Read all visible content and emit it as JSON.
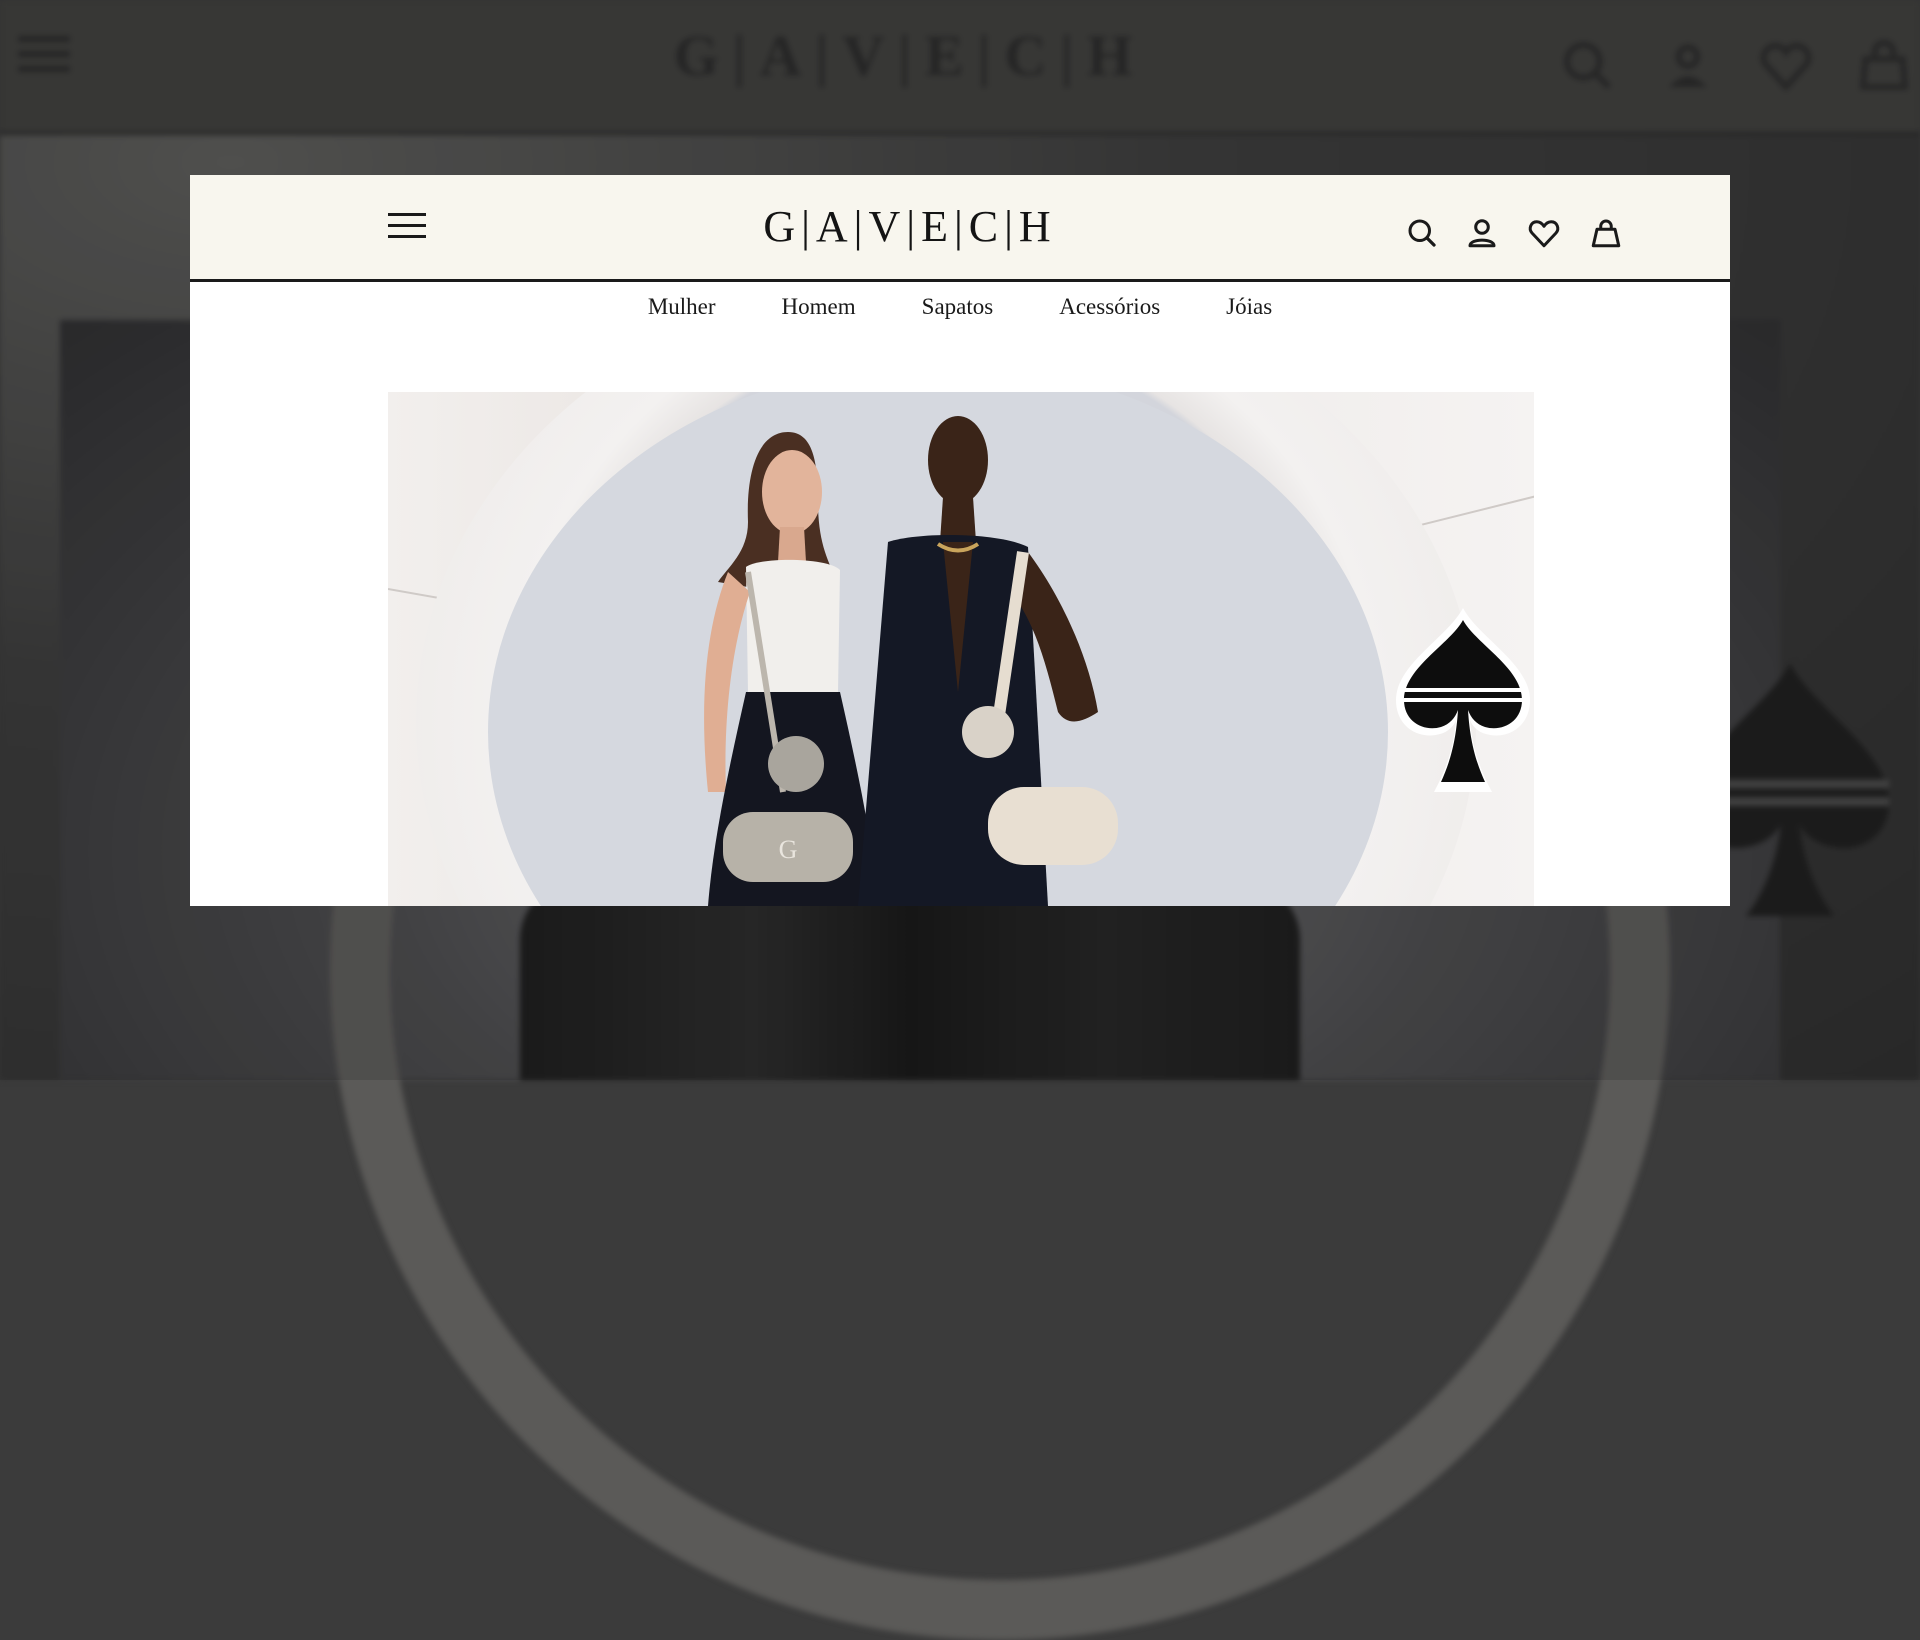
{
  "brand": {
    "logo": "G|A|V|E|C|H"
  },
  "header": {
    "menu_icon": "hamburger-menu-icon",
    "icons": [
      "search-icon",
      "user-icon",
      "heart-icon",
      "bag-icon"
    ]
  },
  "nav": {
    "items": [
      {
        "label": "Mulher"
      },
      {
        "label": "Homem"
      },
      {
        "label": "Sapatos"
      },
      {
        "label": "Acessórios"
      },
      {
        "label": "Jóias"
      }
    ]
  },
  "hero": {
    "image": "two-models-with-handbags",
    "badge_icon": "spade-icon"
  },
  "colors": {
    "header_bg": "#f8f6ee",
    "text": "#1a1a1a",
    "backdrop": "#3b3b3b"
  }
}
